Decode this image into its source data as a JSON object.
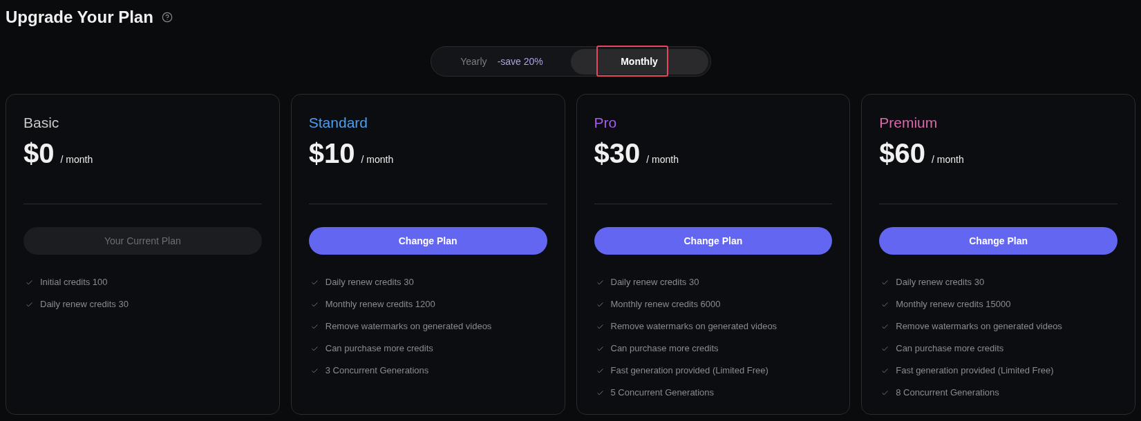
{
  "page": {
    "title": "Upgrade Your Plan"
  },
  "billing_toggle": {
    "options": [
      {
        "label": "Yearly",
        "badge": "-save 20%",
        "selected": false,
        "highlighted": false
      },
      {
        "label": "Monthly",
        "selected": true,
        "highlighted": true
      }
    ]
  },
  "plans": [
    {
      "name": "Basic",
      "color": "#c9c9c9",
      "price": "$0",
      "period": "/ month",
      "button": {
        "label": "Your Current Plan",
        "disabled": true
      },
      "features": [
        "Initial credits 100",
        "Daily renew credits 30"
      ]
    },
    {
      "name": "Standard",
      "color": "#4b9ff2",
      "price": "$10",
      "period": "/ month",
      "button": {
        "label": "Change Plan",
        "disabled": false
      },
      "features": [
        "Daily renew credits 30",
        "Monthly renew credits 1200",
        "Remove watermarks on generated videos",
        "Can purchase more credits",
        "3 Concurrent Generations"
      ]
    },
    {
      "name": "Pro",
      "color": "#a55ce8",
      "price": "$30",
      "period": "/ month",
      "button": {
        "label": "Change Plan",
        "disabled": false
      },
      "features": [
        "Daily renew credits 30",
        "Monthly renew credits 6000",
        "Remove watermarks on generated videos",
        "Can purchase more credits",
        "Fast generation provided (Limited Free)",
        "5 Concurrent Generations"
      ]
    },
    {
      "name": "Premium",
      "color": "#d96aac",
      "price": "$60",
      "period": "/ month",
      "button": {
        "label": "Change Plan",
        "disabled": false
      },
      "features": [
        "Daily renew credits 30",
        "Monthly renew credits 15000",
        "Remove watermarks on generated videos",
        "Can purchase more credits",
        "Fast generation provided (Limited Free)",
        "8 Concurrent Generations"
      ]
    }
  ]
}
